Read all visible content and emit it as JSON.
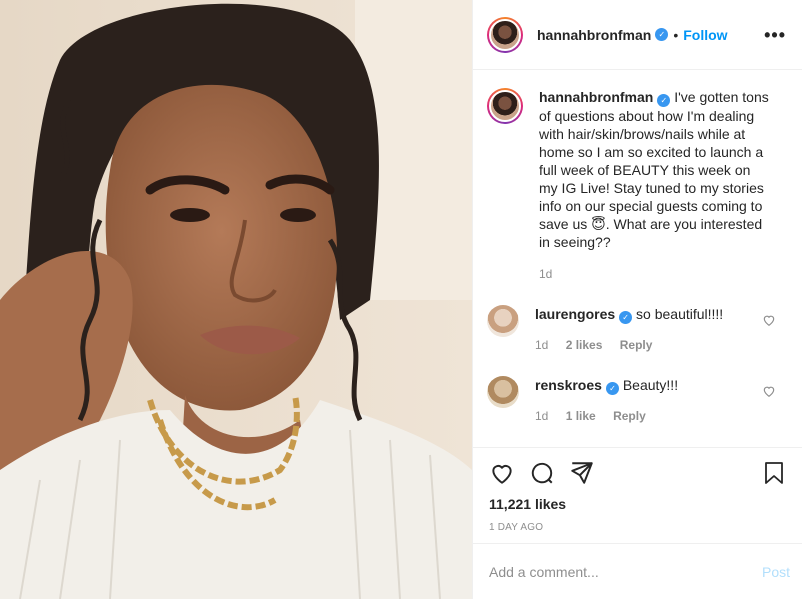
{
  "post": {
    "author": "hannahbronfman",
    "follow_label": "Follow",
    "separator": "•",
    "more_label": "•••",
    "caption": "I've gotten tons of questions about how I'm dealing with hair/skin/brows/nails while at home so I am so excited to launch a full week of BEAUTY this week on my IG Live! Stay tuned to my stories info on our special guests coming to save us 😇. What are you interested in seeing??",
    "caption_time": "1d",
    "likes": "11,221 likes",
    "posted_ago": "1 DAY AGO"
  },
  "comments": [
    {
      "user": "laurengores",
      "text": "so beautiful!!!!",
      "time": "1d",
      "likes": "2 likes",
      "reply": "Reply"
    },
    {
      "user": "renskroes",
      "text": "Beauty!!!",
      "time": "1d",
      "likes": "1 like",
      "reply": "Reply"
    }
  ],
  "add_comment": {
    "placeholder": "Add a comment...",
    "post_label": "Post"
  },
  "icons": {
    "verified": "verified-badge",
    "like": "heart-icon",
    "comment": "comment-icon",
    "share": "share-icon",
    "save": "bookmark-icon"
  },
  "colors": {
    "accent": "#0095f6",
    "verified": "#3897f0",
    "muted": "#8e8e8e",
    "post_disabled": "#b2dffc"
  }
}
